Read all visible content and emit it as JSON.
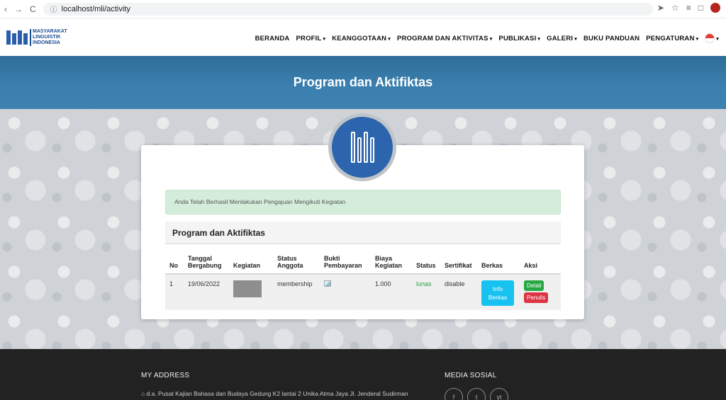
{
  "browser": {
    "url": "localhost/mli/activity"
  },
  "logo": {
    "line1": "MASYARAKAT",
    "line2": "LINGUISTIK",
    "line3": "INDONESIA"
  },
  "nav": [
    {
      "label": "BERANDA",
      "caret": false
    },
    {
      "label": "PROFIL",
      "caret": true
    },
    {
      "label": "KEANGGOTAAN",
      "caret": true
    },
    {
      "label": "PROGRAM DAN AKTIVITAS",
      "caret": true
    },
    {
      "label": "PUBLIKASI",
      "caret": true
    },
    {
      "label": "GALERI",
      "caret": true
    },
    {
      "label": "BUKU PANDUAN",
      "caret": false
    },
    {
      "label": "PENGATURAN",
      "caret": true
    }
  ],
  "banner": {
    "title": "Program dan Aktifiktas"
  },
  "alert": {
    "message": "Anda Telah Berhasil Menlakukan Pengajuan Mengikuti Kegiatan"
  },
  "table": {
    "title": "Program dan Aktifiktas",
    "headers": {
      "no": "No",
      "tanggal_line1": "Tanggal",
      "tanggal_line2": "Bergabung",
      "kegiatan": "Kegiatan",
      "status_line1": "Status",
      "status_line2": "Anggota",
      "bukti_line1": "Bukti",
      "bukti_line2": "Pembayaran",
      "biaya_line1": "Biaya",
      "biaya_line2": "Kegiatan",
      "status": "Status",
      "sertifikat": "Sertifikat",
      "berkas": "Berkas",
      "aksi": "Aksi"
    },
    "rows": [
      {
        "no": "1",
        "tanggal": "19/06/2022",
        "status_anggota": "membership",
        "biaya": "1.000",
        "status": "lunas",
        "sertifikat": "disable",
        "berkas_line1": "Info",
        "berkas_line2": "Berkas",
        "aksi_detail": "Detail",
        "aksi_penulis": "Penulis"
      }
    ]
  },
  "footer": {
    "address_title": "MY ADDRESS",
    "address": "d.a. Pusat Kajian Bahasa dan Budaya Gedung K2 lantai 2 Unika Atma Jaya Jl. Jenderal Sudirman",
    "social_title": "MEDIA SOSIAL",
    "social": [
      "f",
      "t",
      "yt"
    ]
  },
  "colors": {
    "banner": "#3b7fae",
    "accent_blue": "#2c64ad",
    "success": "#28a745",
    "danger": "#dc3545",
    "info": "#17c2f0"
  }
}
